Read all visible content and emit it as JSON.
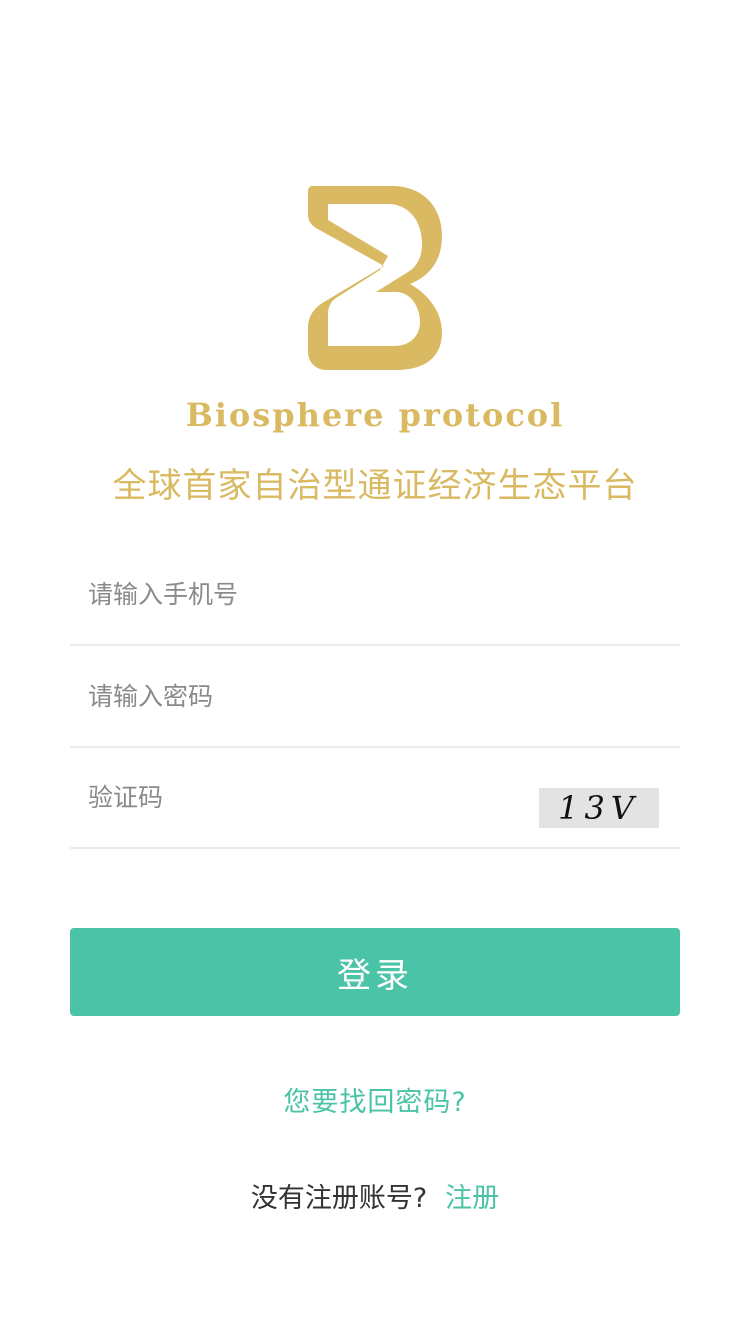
{
  "brand": {
    "name": "Biosphere protocol",
    "tagline": "全球首家自治型通证经济生态平台",
    "logo_color": "#d9b961"
  },
  "form": {
    "phone_placeholder": "请输入手机号",
    "password_placeholder": "请输入密码",
    "captcha_placeholder": "验证码",
    "captcha_image_text": "13V"
  },
  "actions": {
    "login_label": "登录",
    "forgot_password": "您要找回密码?",
    "no_account": "没有注册账号?",
    "register_label": "注册"
  },
  "colors": {
    "accent": "#4bc3a7",
    "brand_gold": "#d9b961",
    "divider": "#ebebeb"
  }
}
